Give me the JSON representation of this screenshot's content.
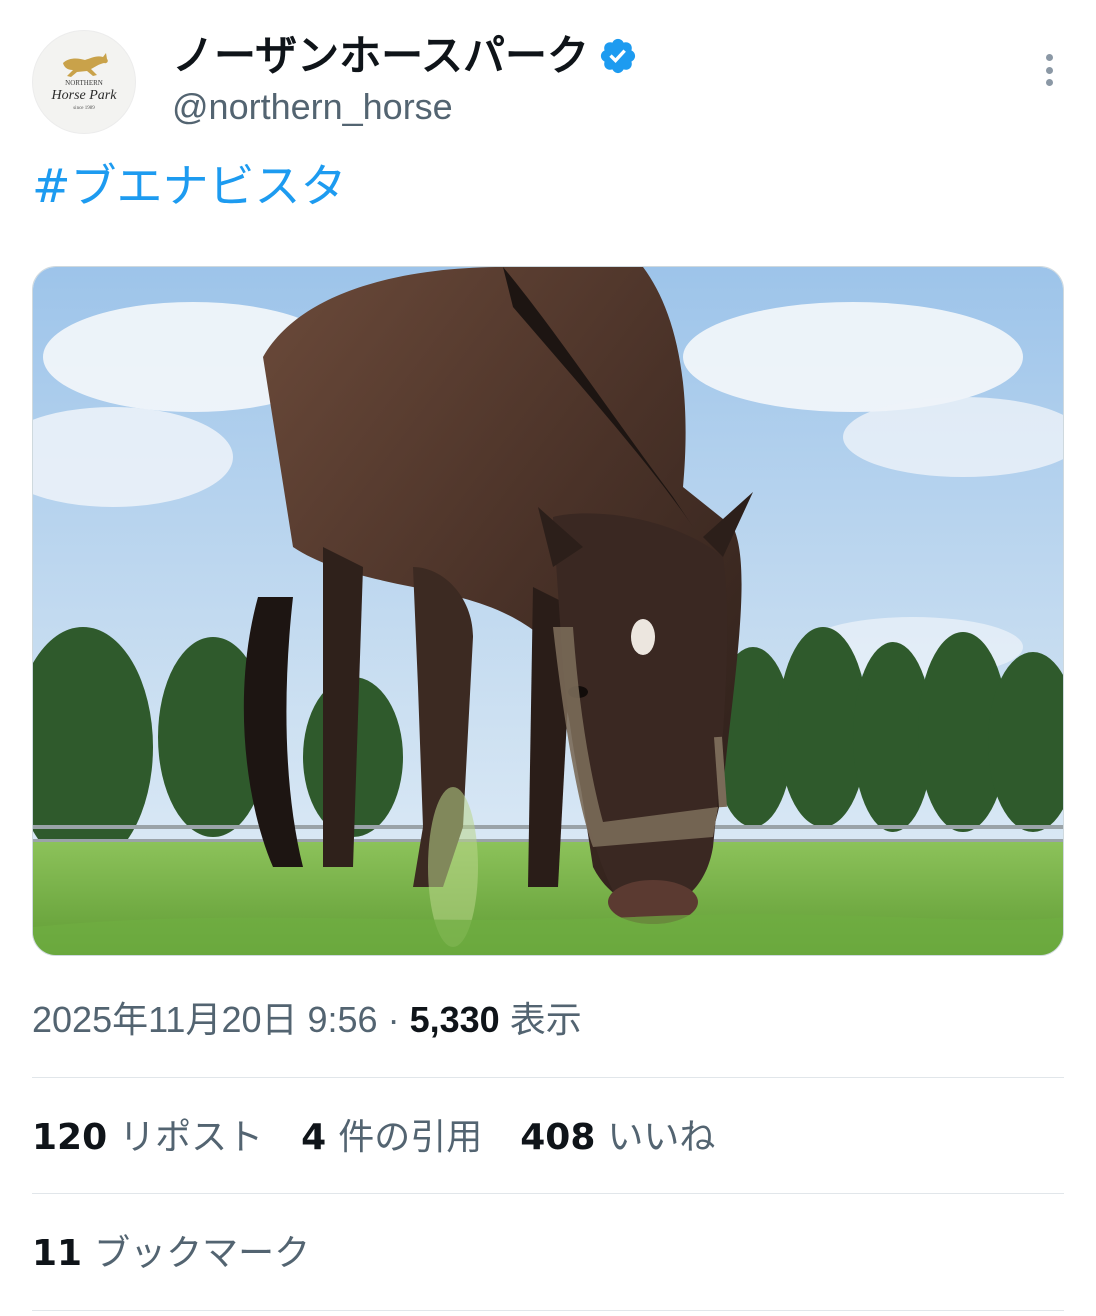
{
  "author": {
    "display_name": "ノーザンホースパーク",
    "handle": "@northern_horse",
    "verified": true,
    "avatar_icon": "northern-horse-park-logo",
    "avatar_text_top": "NORTHERN",
    "avatar_text_main": "Horse Park",
    "avatar_text_since": "since 1989"
  },
  "post": {
    "hashtag": "#ブエナビスタ",
    "image_icon": "horse-grazing-photo"
  },
  "meta": {
    "timestamp": "2025年11月20日 9:56",
    "separator": "·",
    "views_count": "5,330",
    "views_label": "表示"
  },
  "stats": {
    "reposts_count": "120",
    "reposts_label": "リポスト",
    "quotes_count": "4",
    "quotes_label": "件の引用",
    "likes_count": "408",
    "likes_label": "いいね",
    "bookmarks_count": "11",
    "bookmarks_label": "ブックマーク"
  },
  "colors": {
    "link": "#1d9bf0",
    "verified": "#1d9bf0",
    "secondary_text": "#536471",
    "primary_text": "#0f1419"
  }
}
